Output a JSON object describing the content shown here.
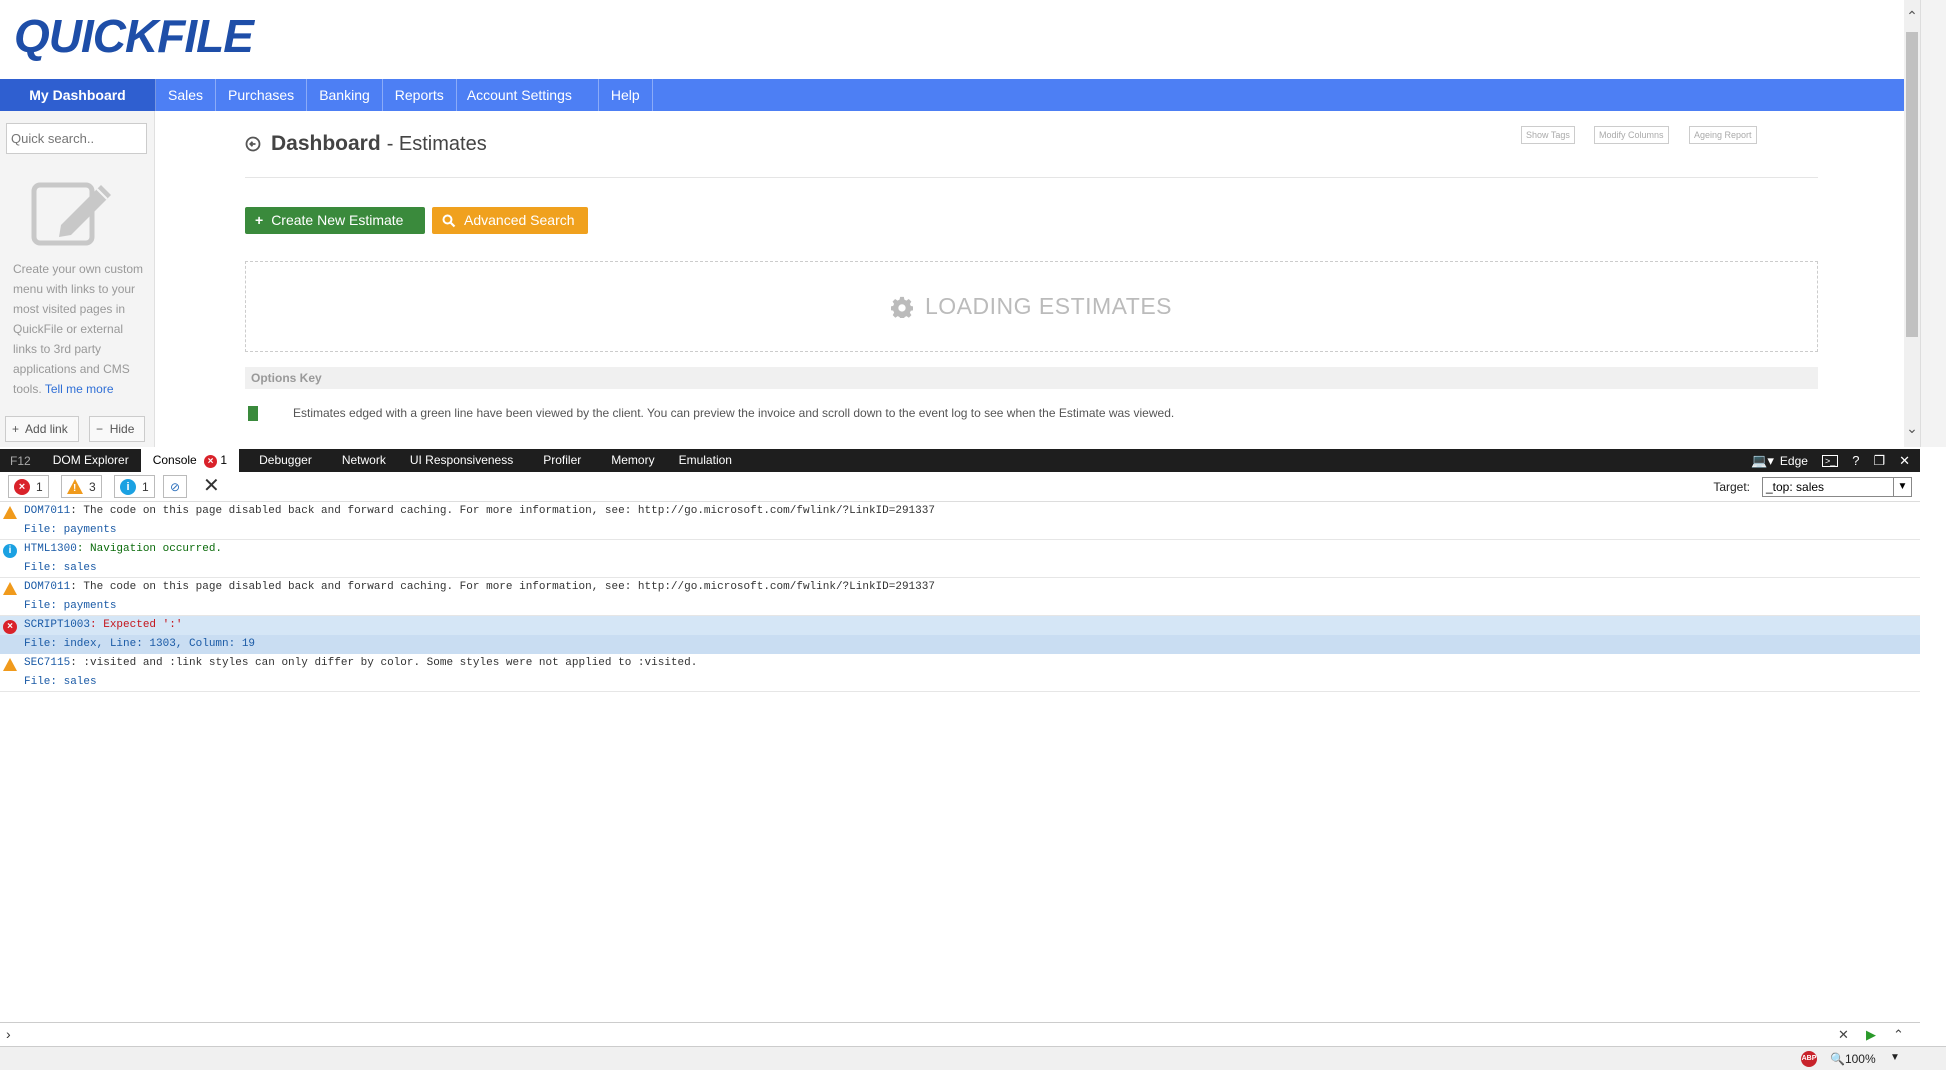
{
  "app": {
    "logo_text": "QUICKFILE",
    "nav": [
      "My Dashboard",
      "Sales",
      "Purchases",
      "Banking",
      "Reports",
      "Account Settings",
      "Help"
    ],
    "sidebar": {
      "search_placeholder": "Quick search..",
      "help_text": "Create your own custom menu with links to your most visited pages in QuickFile or external links to 3rd party applications and CMS tools.",
      "tell_more": "Tell me more",
      "add_link": "Add link",
      "hide": "Hide"
    },
    "page": {
      "title": "Dashboard",
      "subtitle": "- Estimates",
      "buttons": [
        "Show Tags",
        "Modify Columns",
        "Ageing Report"
      ],
      "create_btn": "Create New Estimate",
      "advanced_btn": "Advanced Search",
      "loading": "LOADING ESTIMATES",
      "options_key": "Options Key",
      "key_text": "Estimates edged with a green line have been viewed by the client. You can preview the invoice and scroll down to the event log to see when the Estimate was viewed."
    }
  },
  "devtools": {
    "f12_label": "F12",
    "tabs": [
      "DOM Explorer",
      "Console",
      "Debugger",
      "Network",
      "UI Responsiveness",
      "Profiler",
      "Memory",
      "Emulation"
    ],
    "console_error_count": "1",
    "emulation_mode": "Edge",
    "filters": {
      "errors": "1",
      "warnings": "3",
      "info": "1"
    },
    "target_label": "Target:",
    "target_value": "_top: sales",
    "messages": [
      {
        "type": "warn",
        "code": "DOM7011",
        "text": ": The code on this page disabled back and forward caching. For more information, see: http://go.microsoft.com/fwlink/?LinkID=291337",
        "file": "File: payments"
      },
      {
        "type": "info",
        "code": "HTML1300",
        "text": ": Navigation occurred.",
        "file": "File: sales"
      },
      {
        "type": "warn",
        "code": "DOM7011",
        "text": ": The code on this page disabled back and forward caching. For more information, see: http://go.microsoft.com/fwlink/?LinkID=291337",
        "file": "File: payments"
      },
      {
        "type": "err",
        "code": "SCRIPT1003",
        "text": ": Expected ':'",
        "file": "File: index, Line: 1303, Column: 19"
      },
      {
        "type": "warn",
        "code": "SEC7115",
        "text": ": :visited and :link styles can only differ by color. Some styles were not applied to :visited.",
        "file": "File: sales"
      }
    ],
    "status": {
      "abp": "ABP",
      "zoom": "100%"
    }
  }
}
